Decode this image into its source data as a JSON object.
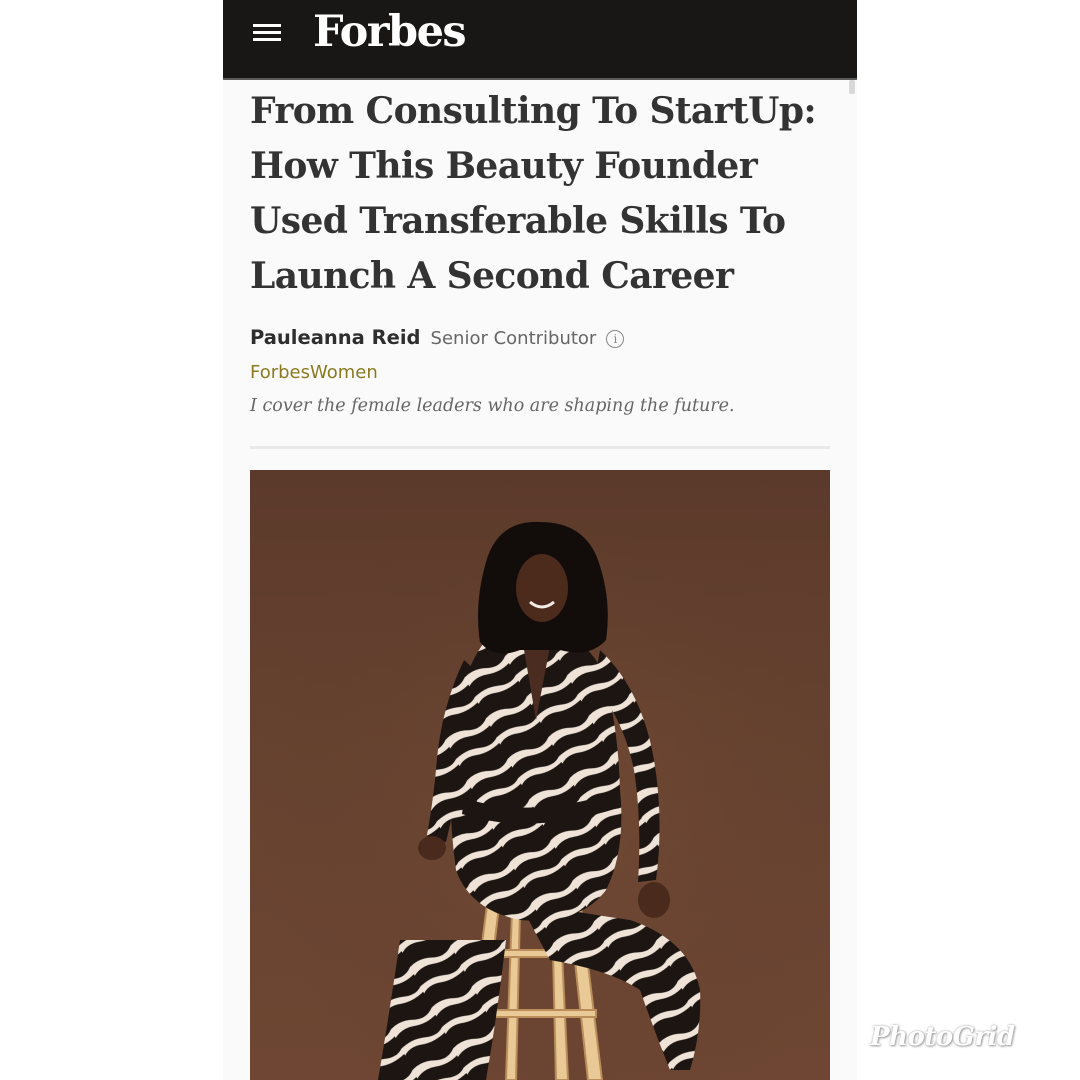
{
  "header": {
    "logo": "Forbes",
    "colors": {
      "bar": "#181716",
      "logo": "#ffffff"
    }
  },
  "article": {
    "headline": "From Consulting To StartUp: How This Beauty Founder Used Transferable Skills To Launch A Second Career",
    "author": "Pauleanna Reid",
    "author_role": "Senior Contributor",
    "channel": "ForbesWomen",
    "tagline": "I cover the female leaders who are shaping the future.",
    "colors": {
      "headline": "#333333",
      "channel": "#8a7a20"
    }
  },
  "icons": {
    "menu": "hamburger-menu-icon",
    "info": "info-circle-icon",
    "info_glyph": "i"
  },
  "watermark": "PhotoGrid"
}
